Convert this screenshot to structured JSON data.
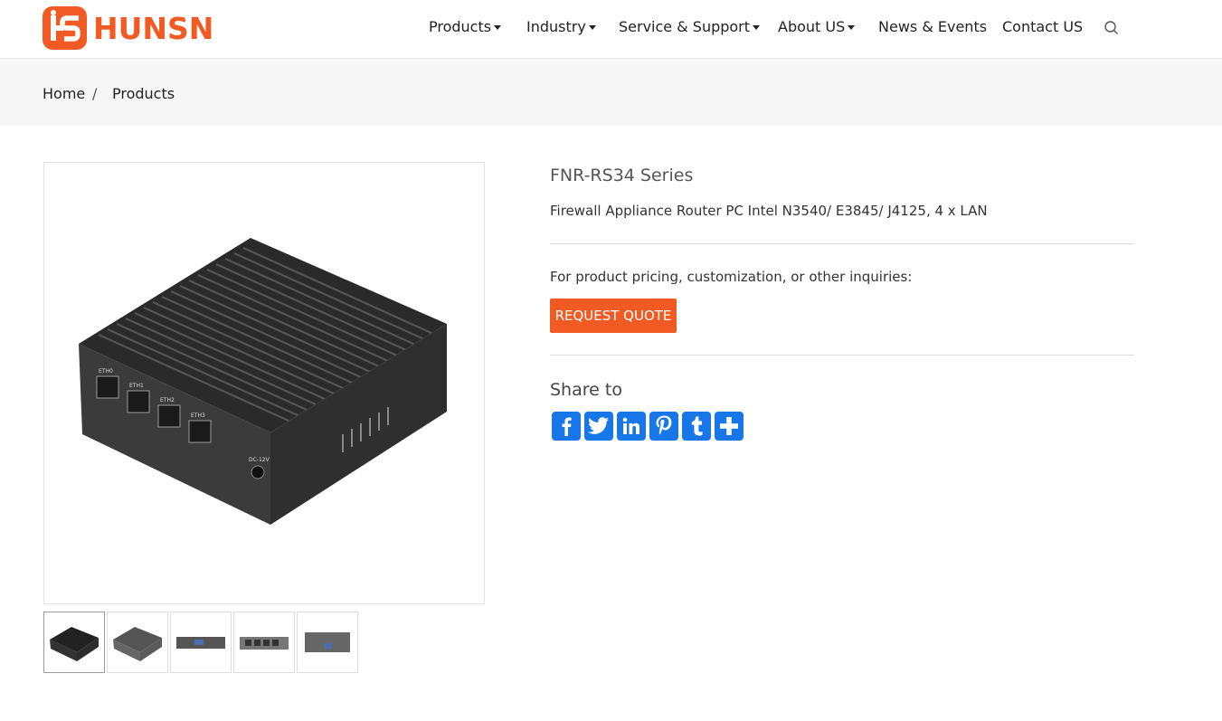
{
  "brand": {
    "name": "HUNSN",
    "color": "#f15a22"
  },
  "nav": {
    "items": [
      {
        "label": "Products",
        "dropdown": true
      },
      {
        "label": "Industry",
        "dropdown": true
      },
      {
        "label": "Service & Support",
        "dropdown": true
      },
      {
        "label": "About US",
        "dropdown": true
      },
      {
        "label": "News & Events",
        "dropdown": false
      },
      {
        "label": "Contact US",
        "dropdown": false
      }
    ],
    "search_icon": "search-icon"
  },
  "breadcrumb": {
    "home": "Home",
    "separator": "/",
    "current": "Products"
  },
  "product": {
    "title": "FNR-RS34 Series",
    "subtitle": "Firewall Appliance Router PC Intel N3540/ E3845/ J4125, 4 x LAN",
    "inquiry_text": "For product pricing, customization, or other inquiries:",
    "quote_button": "REQUEST QUOTE",
    "image_ports": [
      "ETH0",
      "ETH1",
      "ETH2",
      "ETH3"
    ],
    "image_power_label": "DC-12V"
  },
  "share": {
    "title": "Share to",
    "buttons": [
      "facebook-icon",
      "twitter-icon",
      "linkedin-icon",
      "pinterest-icon",
      "tumblr-icon",
      "share-icon"
    ],
    "color": "#1877e8"
  },
  "thumbnails": {
    "count": 5,
    "active_index": 0
  }
}
